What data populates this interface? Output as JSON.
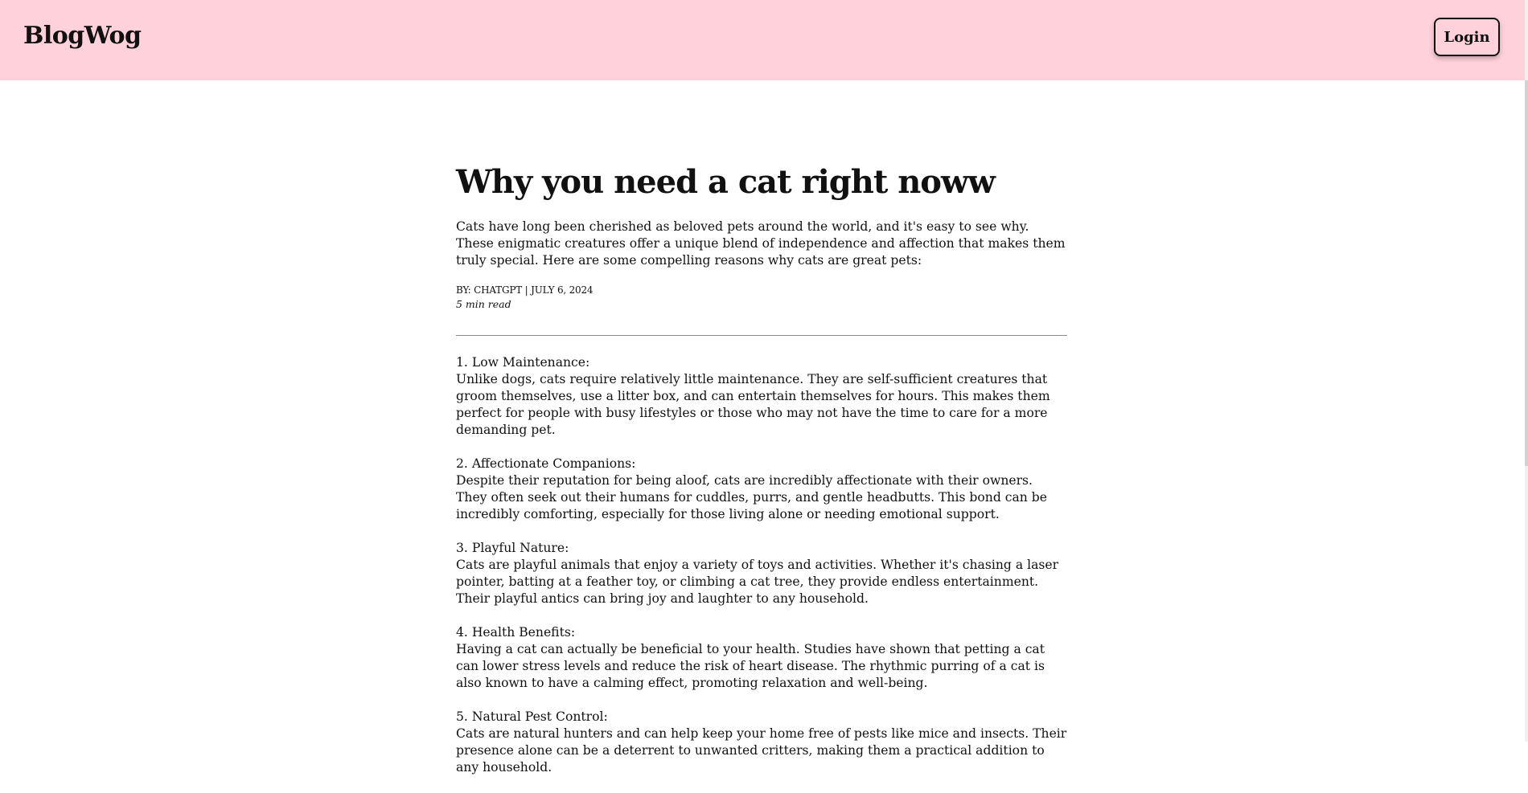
{
  "header": {
    "brand": "BlogWog",
    "login_label": "Login"
  },
  "article": {
    "title": "Why you need a cat right noww",
    "intro": "Cats have long been cherished as beloved pets around the world, and it's easy to see why. These enigmatic creatures offer a unique blend of independence and affection that makes them truly special. Here are some compelling reasons why cats are great pets:",
    "byline": "BY: CHATGPT | JULY 6, 2024",
    "read_time": "5 min read",
    "sections": [
      {
        "heading": "1. Low Maintenance:",
        "body": "Unlike dogs, cats require relatively little maintenance. They are self-sufficient creatures that groom themselves, use a litter box, and can entertain themselves for hours. This makes them perfect for people with busy lifestyles or those who may not have the time to care for a more demanding pet."
      },
      {
        "heading": "2. Affectionate Companions:",
        "body": "Despite their reputation for being aloof, cats are incredibly affectionate with their owners. They often seek out their humans for cuddles, purrs, and gentle headbutts. This bond can be incredibly comforting, especially for those living alone or needing emotional support."
      },
      {
        "heading": "3. Playful Nature:",
        "body": "Cats are playful animals that enjoy a variety of toys and activities. Whether it's chasing a laser pointer, batting at a feather toy, or climbing a cat tree, they provide endless entertainment. Their playful antics can bring joy and laughter to any household."
      },
      {
        "heading": "4. Health Benefits:",
        "body": "Having a cat can actually be beneficial to your health. Studies have shown that petting a cat can lower stress levels and reduce the risk of heart disease. The rhythmic purring of a cat is also known to have a calming effect, promoting relaxation and well-being."
      },
      {
        "heading": "5. Natural Pest Control:",
        "body": "Cats are natural hunters and can help keep your home free of pests like mice and insects. Their presence alone can be a deterrent to unwanted critters, making them a practical addition to any household."
      }
    ]
  },
  "colors": {
    "header_bg": "#ffd1da",
    "text": "#111111",
    "divider": "#8a8a8a"
  }
}
